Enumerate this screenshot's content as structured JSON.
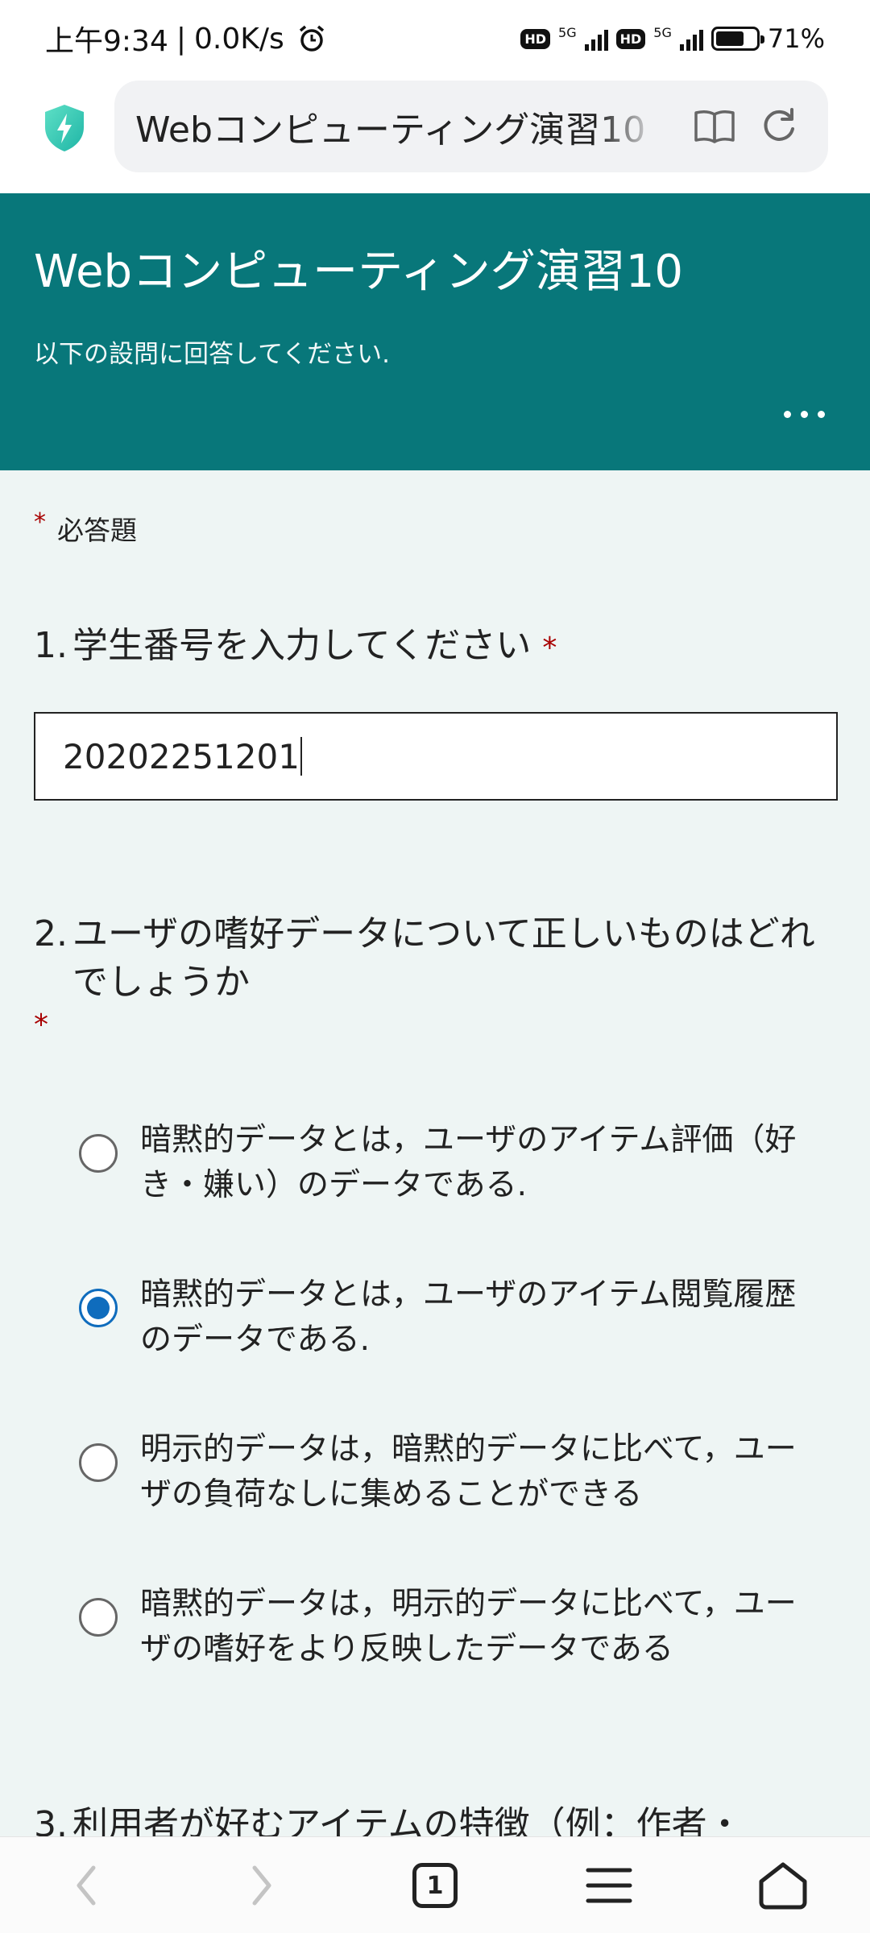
{
  "status_bar": {
    "time": "上午9:34",
    "net_speed": "0.0K/s",
    "battery": "71%",
    "battery_level": 0.71,
    "hd1": "HD",
    "net1": "5G",
    "hd2": "HD",
    "net2": "5G"
  },
  "browser": {
    "url_text": "Webコンピューティング演習10",
    "tab_count": "1"
  },
  "form": {
    "title": "Webコンピューティング演習10",
    "subtitle": "以下の設問に回答してください.",
    "required_star": "*",
    "required_note": "必答題"
  },
  "questions": [
    {
      "number": "1.",
      "text": "学生番号を入力してください",
      "required": "*",
      "answer_value": "20202251201"
    },
    {
      "number": "2.",
      "text": "ユーザの嗜好データについて正しいものはどれでしょうか",
      "required": "*",
      "options": [
        {
          "label": "暗黙的データとは，ユーザのアイテム評価（好き・嫌い）のデータである.",
          "selected": false
        },
        {
          "label": "暗黙的データとは，ユーザのアイテム閲覧履歴のデータである.",
          "selected": true
        },
        {
          "label": "明示的データは，暗黙的データに比べて，ユーザの負荷なしに集めることができる",
          "selected": false
        },
        {
          "label": "暗黙的データは，明示的データに比べて，ユーザの嗜好をより反映したデータである",
          "selected": false
        }
      ]
    },
    {
      "number": "3.",
      "text": "利用者が好むアイテムの特徴（例：作者・"
    }
  ],
  "colors": {
    "header_bg": "#08777a",
    "page_bg": "#eef5f4",
    "required_red": "#a80000",
    "radio_selected": "#0f6cbd"
  },
  "icons": [
    "alarm-icon",
    "shield-icon",
    "reader-icon",
    "reload-icon",
    "back-arrow-icon",
    "forward-arrow-icon",
    "menu-icon",
    "home-icon"
  ]
}
